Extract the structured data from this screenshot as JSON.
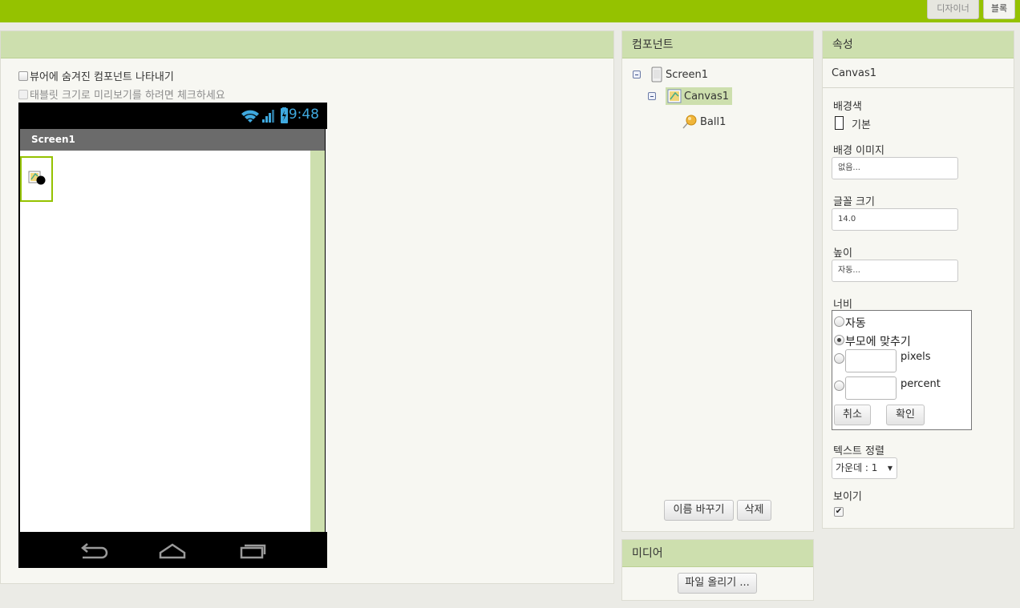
{
  "topbar": {
    "designer_label": "디자이너",
    "blocks_label": "블록",
    "accent": "#95c200"
  },
  "viewer": {
    "show_hidden_label": "뷰어에 숨겨진 컴포넌트 나타내기",
    "tablet_preview_label": "태블릿 크기로 미리보기를 하려면 체크하세요",
    "phone": {
      "time": "9:48",
      "screen_title": "Screen1"
    }
  },
  "components": {
    "header": "컴포넌트",
    "tree": [
      {
        "label": "Screen1",
        "icon": "screen-icon"
      },
      {
        "label": "Canvas1",
        "icon": "canvas-icon",
        "selected": true
      },
      {
        "label": "Ball1",
        "icon": "ball-icon"
      }
    ],
    "rename_label": "이름 바꾸기",
    "delete_label": "삭제"
  },
  "media": {
    "header": "미디어",
    "upload_label": "파일 올리기 ..."
  },
  "properties": {
    "header": "속성",
    "component_name": "Canvas1",
    "bg_color_label": "배경색",
    "bg_color_value": "기본",
    "bg_image_label": "배경 이미지",
    "bg_image_value": "없음...",
    "font_size_label": "글꼴 크기",
    "font_size_value": "14.0",
    "height_label": "높이",
    "height_value": "자동...",
    "width_label": "너비",
    "width_options": {
      "auto": "자동",
      "fill_parent": "부모에 맞추기",
      "pixels": "pixels",
      "percent": "percent",
      "selected": "fill_parent"
    },
    "cancel_label": "취소",
    "ok_label": "확인",
    "text_align_label": "텍스트 정렬",
    "text_align_value": "가운데 : 1",
    "visible_label": "보이기",
    "visible_checked": true
  }
}
